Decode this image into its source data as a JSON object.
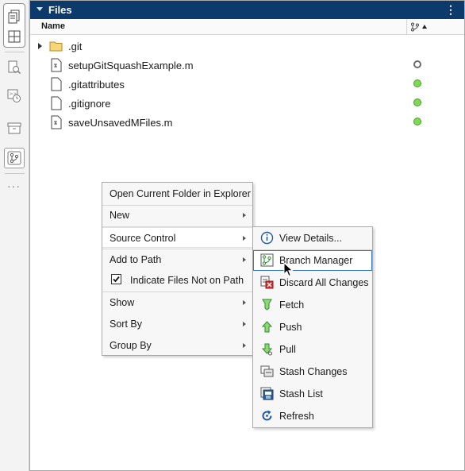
{
  "panel": {
    "title": "Files",
    "column_name": "Name"
  },
  "files": [
    {
      "name": ".git",
      "type": "folder",
      "status": ""
    },
    {
      "name": "setupGitSquashExample.m",
      "type": "mfile",
      "status": "unmodified"
    },
    {
      "name": ".gitattributes",
      "type": "file",
      "status": "added"
    },
    {
      "name": ".gitignore",
      "type": "file",
      "status": "added"
    },
    {
      "name": "saveUnsavedMFiles.m",
      "type": "mfile",
      "status": "added"
    }
  ],
  "context_menu": {
    "items": [
      {
        "label": "Open Current Folder in Explorer"
      },
      {
        "label": "New"
      },
      {
        "label": "Source Control"
      },
      {
        "label": "Add to Path"
      },
      {
        "label": "Indicate Files Not on Path",
        "checked": true
      },
      {
        "label": "Show"
      },
      {
        "label": "Sort By"
      },
      {
        "label": "Group By"
      }
    ]
  },
  "source_control_menu": {
    "items": [
      {
        "label": "View Details...",
        "icon": "info-icon"
      },
      {
        "label": "Branch Manager",
        "icon": "branch-icon"
      },
      {
        "label": "Discard All Changes",
        "icon": "discard-icon"
      },
      {
        "label": "Fetch",
        "icon": "fetch-icon"
      },
      {
        "label": "Push",
        "icon": "push-icon"
      },
      {
        "label": "Pull",
        "icon": "pull-icon"
      },
      {
        "label": "Stash Changes",
        "icon": "stash-icon"
      },
      {
        "label": "Stash List",
        "icon": "stash-list-icon"
      },
      {
        "label": "Refresh",
        "icon": "refresh-icon"
      }
    ]
  },
  "colors": {
    "header_bg": "#0b3a6b",
    "added_status": "#7ed957",
    "focus_outline": "#3a78c2"
  }
}
